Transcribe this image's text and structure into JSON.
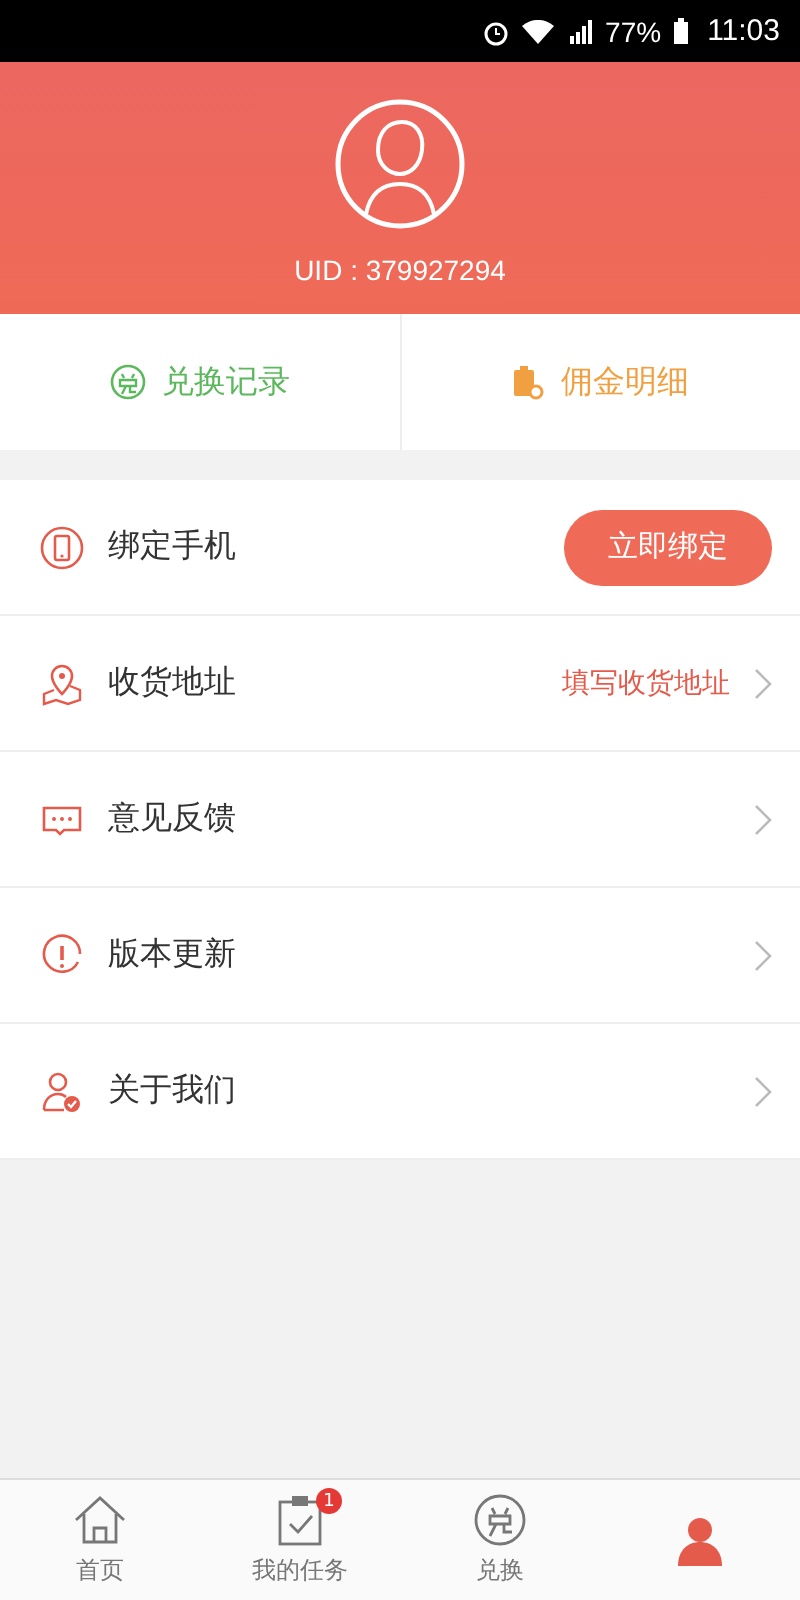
{
  "status_bar": {
    "battery": "77%",
    "time": "11:03"
  },
  "profile": {
    "uid": "UID : 379927294"
  },
  "quick_links": [
    {
      "kind": "exchange",
      "label": "兑换记录",
      "color": "#5cb85c"
    },
    {
      "kind": "commission",
      "label": "佣金明细",
      "color": "#f0a040"
    }
  ],
  "menu": [
    {
      "kind": "phone",
      "label": "绑定手机",
      "action": "立即绑定"
    },
    {
      "kind": "address",
      "label": "收货地址",
      "value": "填写收货地址",
      "chevron": true
    },
    {
      "kind": "feedback",
      "label": "意见反馈",
      "chevron": true
    },
    {
      "kind": "update",
      "label": "版本更新",
      "chevron": true
    },
    {
      "kind": "about",
      "label": "关于我们",
      "chevron": true
    }
  ],
  "tab_bar": [
    {
      "kind": "home",
      "label": "首页",
      "selected": false
    },
    {
      "kind": "tasks",
      "label": "我的任务",
      "badge": "1",
      "selected": false
    },
    {
      "kind": "exchange",
      "label": "兑换",
      "selected": false
    },
    {
      "kind": "me",
      "selected": true
    }
  ]
}
